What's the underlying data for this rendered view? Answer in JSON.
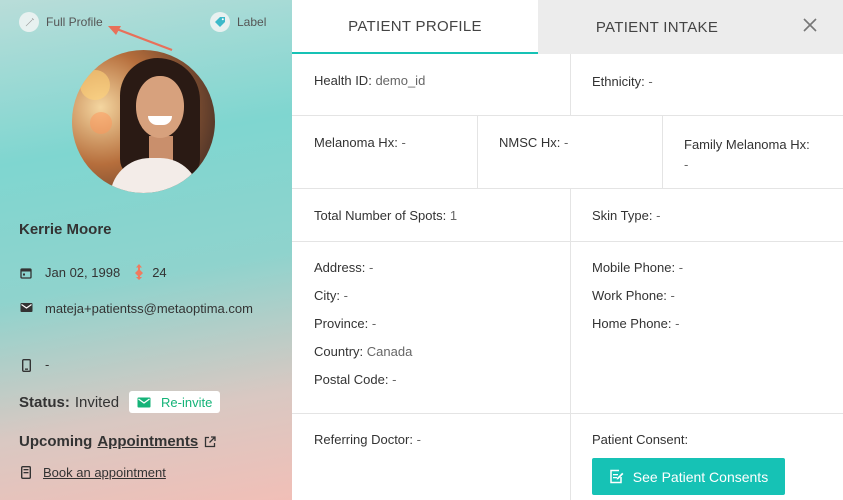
{
  "sidebar": {
    "full_profile_label": "Full Profile",
    "label_action": "Label",
    "patient_name": "Kerrie Moore",
    "dob": "Jan 02, 1998",
    "age": "24",
    "email": "mateja+patientss@metaoptima.com",
    "phone": "-",
    "status_label": "Status:",
    "status_value": "Invited",
    "reinvite_label": "Re-invite",
    "upcoming_label": "Upcoming",
    "appointments_link": "Appointments",
    "book_label": "Book an appointment"
  },
  "tabs": {
    "patient_profile": "PATIENT PROFILE",
    "patient_intake": "PATIENT INTAKE"
  },
  "profile": {
    "health_id_label": "Health ID:",
    "health_id_value": "demo_id",
    "ethnicity_label": "Ethnicity:",
    "ethnicity_value": "-",
    "melanoma_label": "Melanoma Hx:",
    "melanoma_value": "-",
    "nmsc_label": "NMSC Hx:",
    "nmsc_value": "-",
    "family_melanoma_label": "Family Melanoma Hx:",
    "family_melanoma_value": "-",
    "spots_label": "Total Number of Spots:",
    "spots_value": "1",
    "skin_type_label": "Skin Type:",
    "skin_type_value": "-",
    "address_label": "Address:",
    "address_value": "-",
    "city_label": "City:",
    "city_value": "-",
    "province_label": "Province:",
    "province_value": "-",
    "country_label": "Country:",
    "country_value": "Canada",
    "postal_label": "Postal Code:",
    "postal_value": "-",
    "mobile_label": "Mobile Phone:",
    "mobile_value": "-",
    "work_label": "Work Phone:",
    "work_value": "-",
    "home_label": "Home Phone:",
    "home_value": "-",
    "referring_label": "Referring Doctor:",
    "referring_value": "-",
    "consent_label": "Patient Consent:",
    "consent_button": "See Patient Consents"
  },
  "colors": {
    "accent": "#16c2b5",
    "reinvite_green": "#15b378",
    "age_icon": "#ef7a5f",
    "arrow": "#e8705a"
  },
  "icons": [
    "pencil-icon",
    "tag-icon",
    "calendar-icon",
    "gender-icon",
    "envelope-icon",
    "phone-icon",
    "external-link-icon",
    "appointment-book-icon",
    "edit-note-icon",
    "close-icon"
  ]
}
